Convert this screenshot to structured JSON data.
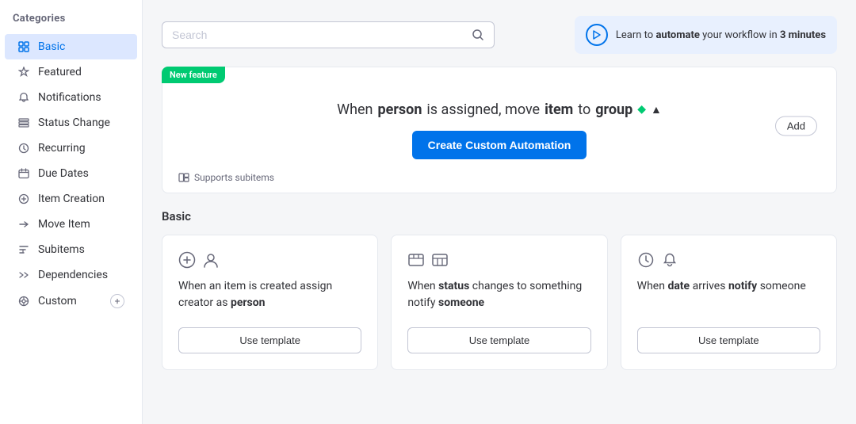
{
  "sidebar": {
    "title": "Categories",
    "items": [
      {
        "id": "basic",
        "label": "Basic",
        "icon": "grid",
        "active": true
      },
      {
        "id": "featured",
        "label": "Featured",
        "icon": "star"
      },
      {
        "id": "notifications",
        "label": "Notifications",
        "icon": "bell"
      },
      {
        "id": "status-change",
        "label": "Status Change",
        "icon": "list"
      },
      {
        "id": "recurring",
        "label": "Recurring",
        "icon": "clock"
      },
      {
        "id": "due-dates",
        "label": "Due Dates",
        "icon": "clock"
      },
      {
        "id": "item-creation",
        "label": "Item Creation",
        "icon": "plus"
      },
      {
        "id": "move-item",
        "label": "Move Item",
        "icon": "arrow-right"
      },
      {
        "id": "subitems",
        "label": "Subitems",
        "icon": "subitems"
      },
      {
        "id": "dependencies",
        "label": "Dependencies",
        "icon": "dependencies"
      },
      {
        "id": "custom",
        "label": "Custom",
        "icon": "custom"
      }
    ]
  },
  "search": {
    "placeholder": "Search"
  },
  "automate_banner": {
    "text_prefix": "Learn to ",
    "text_bold": "automate",
    "text_suffix": " your workflow in ",
    "text_minutes": "3 minutes"
  },
  "feature_banner": {
    "badge": "New feature",
    "text": "When",
    "bold1": "person",
    "text2": "is assigned, move",
    "bold2": "item",
    "text3": "to",
    "bold3": "group",
    "add_label": "Add",
    "create_btn": "Create Custom Automation",
    "supports": "Supports subitems"
  },
  "basic_section": {
    "title": "Basic"
  },
  "cards": [
    {
      "desc_pre": "When an item is created assign creator as",
      "desc_bold": "person",
      "btn_label": "Use template"
    },
    {
      "desc_pre": "When",
      "desc_bold1": "status",
      "desc_mid": "changes to something notify",
      "desc_bold2": "someone",
      "btn_label": "Use template"
    },
    {
      "desc_pre": "When",
      "desc_bold1": "date",
      "desc_mid": "arrives",
      "desc_bold2": "notify",
      "desc_post": "someone",
      "btn_label": "Use template"
    }
  ]
}
